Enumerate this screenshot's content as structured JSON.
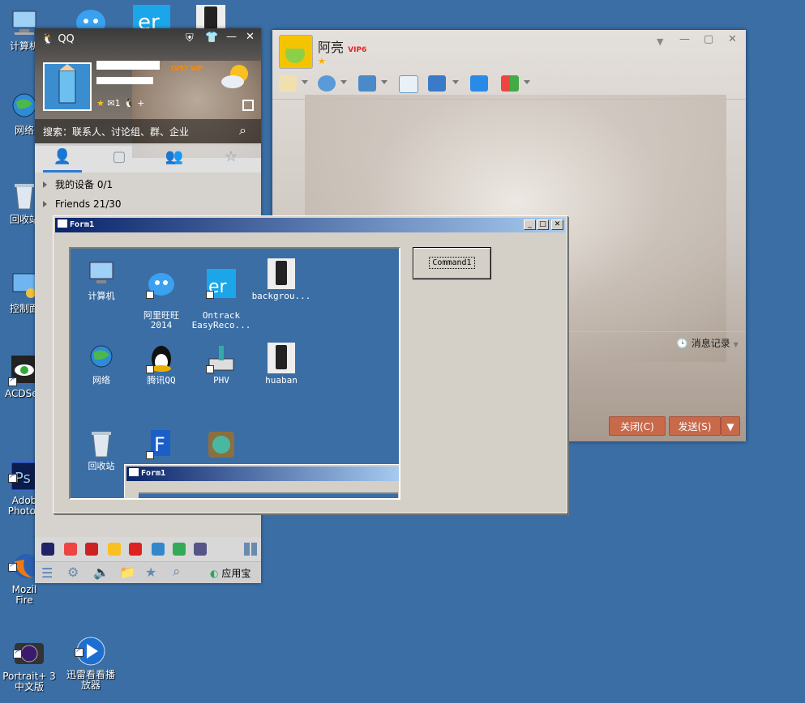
{
  "desktop": {
    "icons": [
      {
        "label": "计算机"
      },
      {
        "label": "网络"
      },
      {
        "label": "回收站"
      },
      {
        "label": "控制面"
      },
      {
        "label": "ACDSee"
      },
      {
        "label": "Adob\nPhotos"
      },
      {
        "label": "Mozil\nFire"
      },
      {
        "label": "Portrait+ 3\n中文版"
      },
      {
        "label": "迅雷看看播\n放器"
      }
    ]
  },
  "qq": {
    "title": "QQ",
    "level_badge": "LV57",
    "vip_badge": "VIP",
    "mail_count": "1",
    "search_placeholder": "搜索：联系人、讨论组、群、企业",
    "groups": [
      {
        "name": "我的设备 0/1"
      },
      {
        "name": "Friends 21/30"
      }
    ],
    "app_store_label": "应用宝"
  },
  "chat": {
    "contact_name": "阿亮",
    "vip_badge": "VIP6",
    "history_label": "消息记录",
    "close_button": "关闭(C)",
    "send_button": "发送(S)"
  },
  "form1": {
    "title": "Form1",
    "command_button": "Command1",
    "inner_icons": [
      {
        "label": "计算机"
      },
      {
        "label": "阿里旺旺\n2014"
      },
      {
        "label": "Ontrack\nEasyReco..."
      },
      {
        "label": "backgrou..."
      },
      {
        "label": "网络"
      },
      {
        "label": "腾讯QQ"
      },
      {
        "label": "PHV"
      },
      {
        "label": "huaban"
      },
      {
        "label": "回收站"
      }
    ],
    "nested_title": "Form1"
  }
}
